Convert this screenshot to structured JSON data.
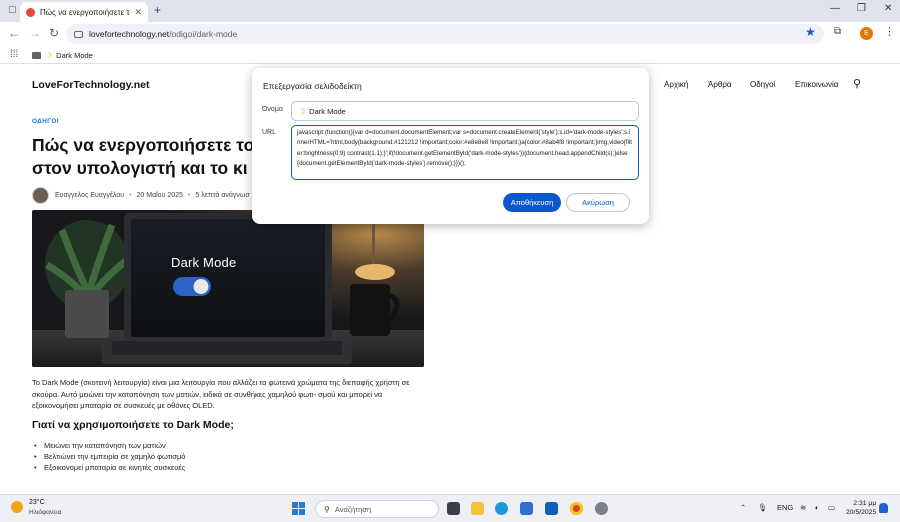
{
  "browser": {
    "tab_title": "Πώς να ενεργοποιήσετε το Dark M",
    "tab_close": "✕",
    "new_tab": "+",
    "url_domain": "lovefortechnology.net",
    "url_path": "/odigoi/dark-mode",
    "profile_initial": "E",
    "bookmark_label": "Dark Mode"
  },
  "site": {
    "logo": "LoveForTechnology.net",
    "nav": [
      "Αρχική",
      "Άρθρα",
      "Οδηγοί",
      "Επικοινωνία"
    ]
  },
  "article": {
    "category": "ΟΔΗΓΟΙ",
    "headline_line1": "Πώς να ενεργοποιήσετε το",
    "headline_line2": "στον υπολογιστή και το κι",
    "author": "Ευαγγελος Ευαγγέλου",
    "date": "20 Μαΐου 2025",
    "read_time": "5 λεπτά ανάγνωσ",
    "hero_caption": "Dark Mode",
    "paragraph": "Το Dark Mode (σκοτεινή λειτουργία) είναι μια λειτουργία που αλλάζει τα φωτεινά χρώματα της διεπαφής χρήστη σε σκούρα. Αυτό μειώνει την καταπόνηση των ματιών, ειδικά σε συνθήκες χαμηλού φωτι- σμού και μπορεί να εξοικονομήσει μπαταρία σε συσκευές με οθόνες OLED.",
    "subheading": "Γιατί να χρησιμοποιήσετε το Dark Mode;",
    "bullets": [
      "Μειώνει την καταπόνηση των ματιών",
      "Βελτιώνει την εμπειρία σε χαμηλό φωτισμό",
      "Εξοικονομεί μπαταρία σε κινητές συσκευές"
    ]
  },
  "dialog": {
    "title": "Επεξεργασία σελιδοδείκτη",
    "name_label": "Όνομα",
    "name_value": "Dark Mode",
    "url_label": "URL",
    "url_value": "javascript:(function(){var d=document.documentElement;var s=document.createElement('style');s.id='dark-mode-styles';s.innerHTML='html,body{background:#121212 !important;color:#e8e8e8 !important;}a{color:#8ab4f8 !important;}img,video{filter:brightness(0.9) contrast(1.1);}';if(!document.getElementById('dark-mode-styles')){document.head.appendChild(s);}else{document.getElementById('dark-mode-styles').remove();}})();",
    "save_label": "Αποθήκευση",
    "cancel_label": "Ακύρωση"
  },
  "taskbar": {
    "temperature": "23°C",
    "weather": "Ηλιόφανεια",
    "search_placeholder": "Αναζήτηση",
    "language": "ENG",
    "time": "2:31 μμ",
    "date": "20/5/2025"
  },
  "colors": {
    "accent": "#0b57d0",
    "category": "#1a73e8",
    "tabstrip": "#dfe3eb"
  }
}
